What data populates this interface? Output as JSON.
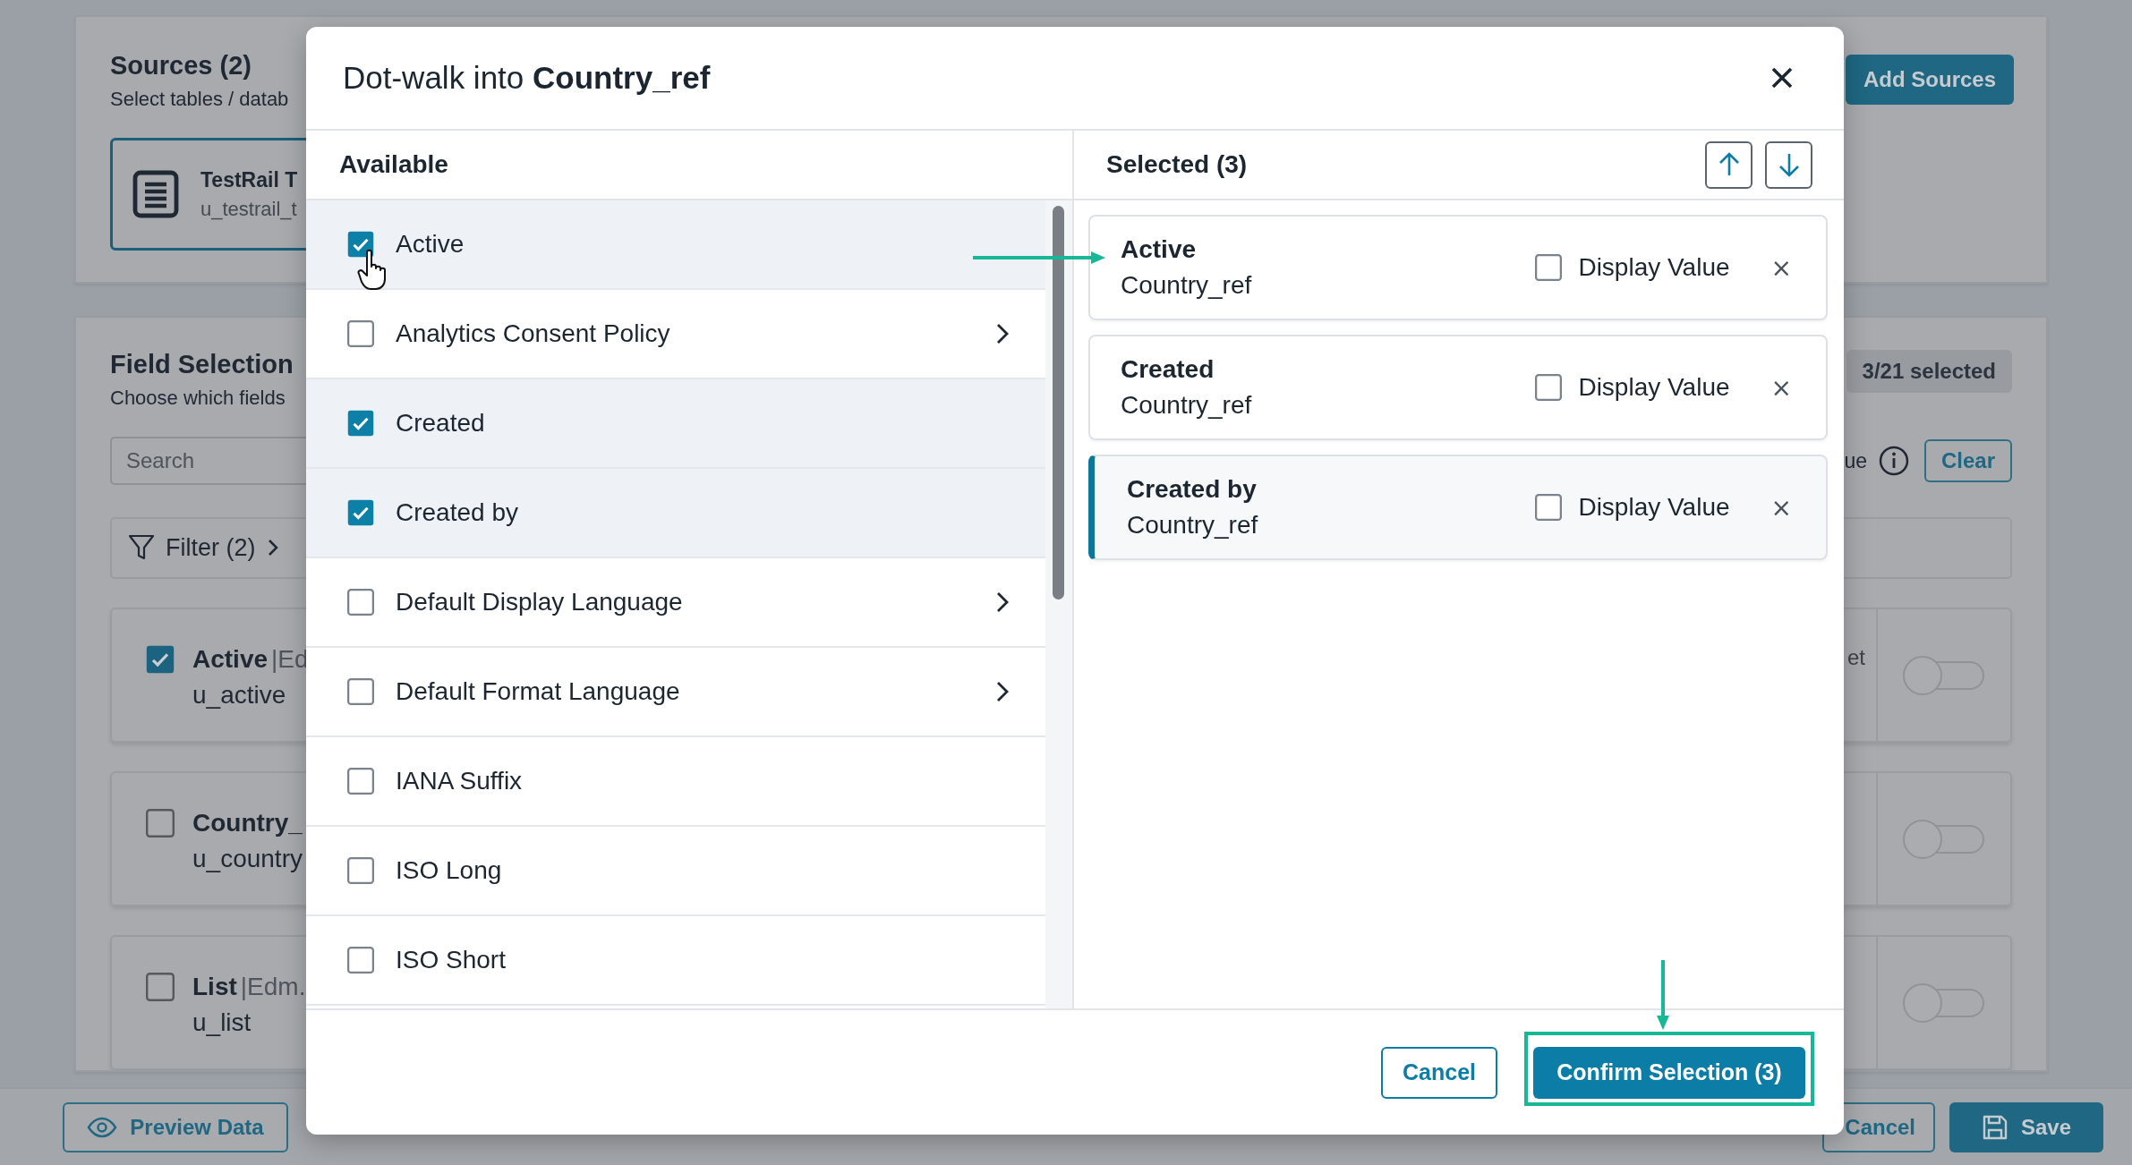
{
  "background": {
    "sources": {
      "title": "Sources (2)",
      "subtitle": "Select tables / datab",
      "add_button": "Add Sources",
      "source_tile": {
        "name": "TestRail T",
        "table": "u_testrail_t"
      }
    },
    "field_selection": {
      "title": "Field Selection",
      "subtitle": "Choose which fields",
      "count": "3/21 selected",
      "search": {
        "placeholder": "Search"
      },
      "option_label": "ue",
      "clear_button": "Clear",
      "filter": "Filter (2)",
      "fields": [
        {
          "name": "Active",
          "type": "|Ed",
          "api": "u_active",
          "extra": "et",
          "checked": true,
          "on": false
        },
        {
          "name": "Country_",
          "api": "u_country",
          "checked": false,
          "on": false
        },
        {
          "name": "List",
          "type": "|Edm.",
          "api": "u_list",
          "checked": false,
          "on": false
        }
      ]
    },
    "footer": {
      "preview_button": "Preview Data",
      "cancel_button": "Cancel",
      "save_button": "Save"
    }
  },
  "dialog": {
    "title": "Dot-walk into **Country_ref**",
    "available": {
      "heading": "Available",
      "items": [
        {
          "label": "Active",
          "checked": true,
          "expandable": false
        },
        {
          "label": "Analytics Consent Policy",
          "checked": false,
          "expandable": true
        },
        {
          "label": "Created",
          "checked": true,
          "expandable": false
        },
        {
          "label": "Created by",
          "checked": true,
          "expandable": false
        },
        {
          "label": "Default Display Language",
          "checked": false,
          "expandable": true
        },
        {
          "label": "Default Format Language",
          "checked": false,
          "expandable": true
        },
        {
          "label": "IANA Suffix",
          "checked": false,
          "expandable": false
        },
        {
          "label": "ISO Long",
          "checked": false,
          "expandable": false
        },
        {
          "label": "ISO Short",
          "checked": false,
          "expandable": false
        }
      ]
    },
    "selected": {
      "heading": "Selected (3)",
      "items": [
        {
          "name": "Active",
          "table": "Country_ref",
          "display_label": "Display Value",
          "display_value": false,
          "remove": "×",
          "selected": false
        },
        {
          "name": "Created",
          "table": "Country_ref",
          "display_label": "Display Value",
          "display_value": false,
          "remove": "×",
          "selected": false
        },
        {
          "name": "Created by",
          "table": "Country_ref",
          "display_label": "Display Value",
          "display_value": false,
          "remove": "×",
          "selected": true
        }
      ]
    },
    "cancel_button": "Cancel",
    "confirm_button": "Confirm Selection (3)"
  }
}
